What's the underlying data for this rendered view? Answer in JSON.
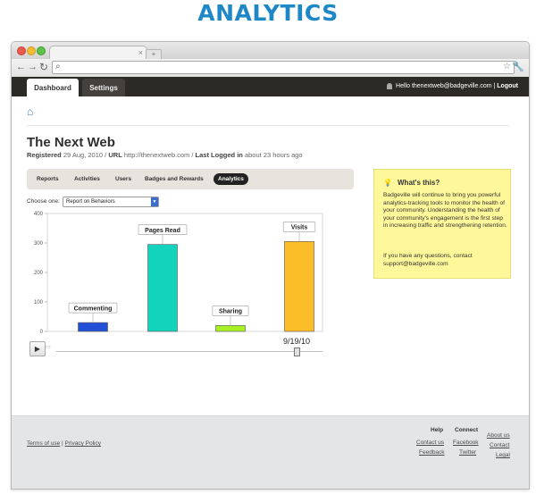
{
  "banner": {
    "title": "ANALYTICS"
  },
  "browser": {
    "url": "",
    "tab_close": "×",
    "new_tab": "+"
  },
  "header": {
    "tabs": [
      {
        "label": "Dashboard",
        "active": true
      },
      {
        "label": "Settings",
        "active": false
      }
    ],
    "greeting": "Hello thenextweb@badgeville.com",
    "separator": "|",
    "logout": "Logout"
  },
  "site": {
    "name": "The Next Web",
    "registered_label": "Registered",
    "registered_value": "29 Aug, 2010",
    "url_label": "URL",
    "url_value": "http://thenextweb.com",
    "last_logged_label": "Last Logged in",
    "last_logged_value": "about 23 hours ago",
    "sep": "/"
  },
  "analytics_nav": {
    "items": [
      "Reports",
      "Activities",
      "Users",
      "Badges and Rewards",
      "Analytics"
    ],
    "active": "Analytics"
  },
  "report_select": {
    "label": "Choose one:",
    "value": "Report on Behaviors"
  },
  "chart_data": {
    "type": "bar",
    "categories": [
      "Commenting",
      "Pages Read",
      "Sharing",
      "Visits"
    ],
    "values": [
      30,
      295,
      20,
      305
    ],
    "colors": [
      "#2450d8",
      "#13d3bd",
      "#a6f125",
      "#fbbe28"
    ],
    "ylim": [
      0,
      400
    ],
    "yticks": [
      0,
      100,
      200,
      300,
      400
    ],
    "grid": false
  },
  "timeline": {
    "date": "9/19/10",
    "play": "▶"
  },
  "help": {
    "title": "What's this?",
    "text": "Badgeville will continue to bring you powerful analytics-tracking tools to monitor the health of your community. Understanding the health of your community's engagement is the first step in increasing traffic and strengthening retention.",
    "contact": "If you have any questions, contact support@badgeville.com"
  },
  "footer": {
    "terms": "Terms of use",
    "privacy": "Privacy Policy",
    "sep": "|",
    "help_title": "Help",
    "help_links": [
      "Contact us",
      "Feedback"
    ],
    "connect_title": "Connect",
    "connect_links": [
      "Facebook",
      "Twitter"
    ],
    "about_links": [
      "About us",
      "Contact",
      "Legal"
    ]
  },
  "icons": {
    "home": "home-icon",
    "wrench": "wrench-icon",
    "bulb": "bulb-icon",
    "user": "user-icon"
  }
}
